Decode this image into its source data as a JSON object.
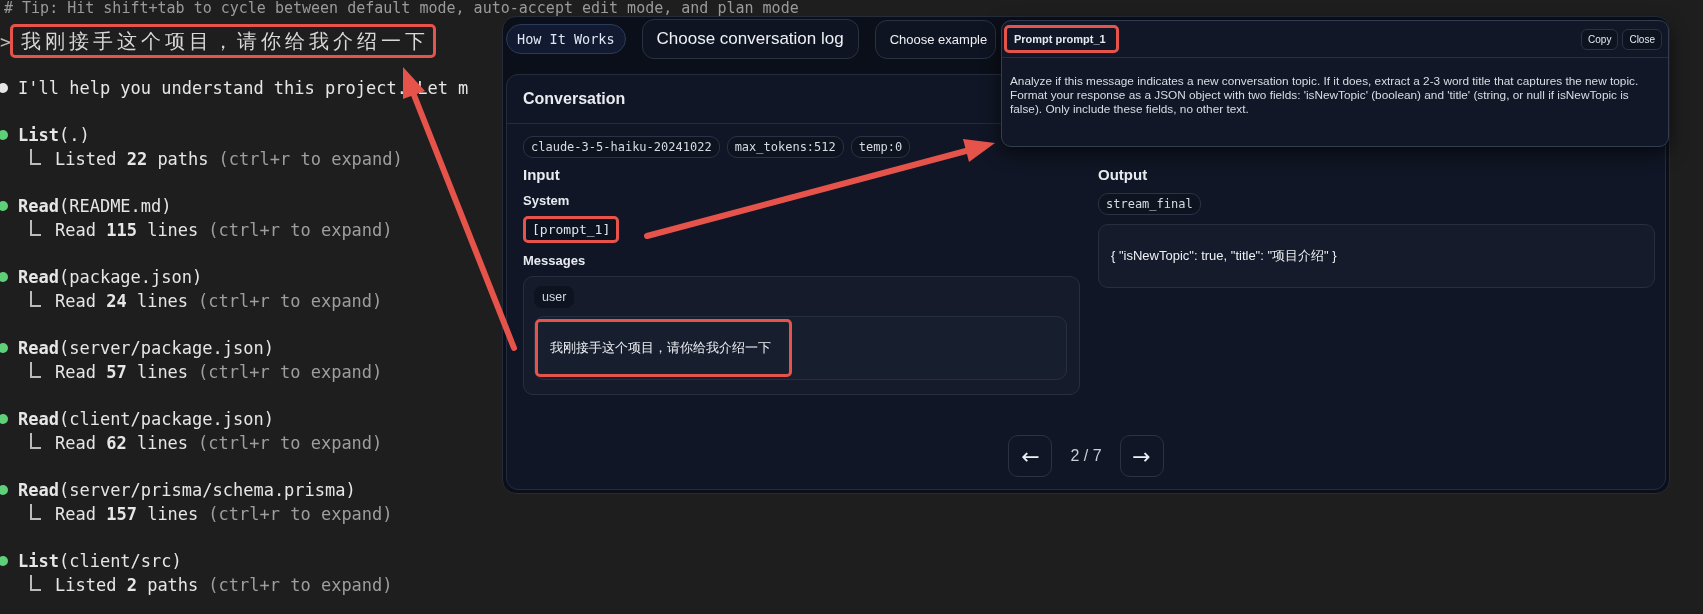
{
  "terminal": {
    "tip": "# Tip: Hit shift+tab to cycle between default mode, auto-accept edit mode, and plan mode",
    "prompt": {
      "marker": ">",
      "text": "我刚接手这个项目，请你给我介绍一下",
      "highlighted": true
    },
    "messages": [
      {
        "kind": "text",
        "color": "#e6e6e6",
        "text": "I'll help you understand this project. Let m"
      },
      {
        "kind": "tool",
        "color": "#5fd07a",
        "call": "**List**(.)",
        "result": "Listed **22** paths",
        "hint": "(ctrl+r to expand)"
      },
      {
        "kind": "tool",
        "color": "#5fd07a",
        "call": "**Read**(README.md)",
        "result": "Read **115** lines",
        "hint": "(ctrl+r to expand)"
      },
      {
        "kind": "tool",
        "color": "#5fd07a",
        "call": "**Read**(package.json)",
        "result": "Read **24** lines",
        "hint": "(ctrl+r to expand)"
      },
      {
        "kind": "tool",
        "color": "#5fd07a",
        "call": "**Read**(server/package.json)",
        "result": "Read **57** lines",
        "hint": "(ctrl+r to expand)"
      },
      {
        "kind": "tool",
        "color": "#5fd07a",
        "call": "**Read**(client/package.json)",
        "result": "Read **62** lines",
        "hint": "(ctrl+r to expand)"
      },
      {
        "kind": "tool",
        "color": "#5fd07a",
        "call": "**Read**(server/prisma/schema.prisma)",
        "result": "Read **157** lines",
        "hint": "(ctrl+r to expand)"
      },
      {
        "kind": "tool",
        "color": "#5fd07a",
        "call": "**List**(client/src)",
        "result": "Listed **2** paths",
        "hint": "(ctrl+r to expand)"
      }
    ]
  },
  "app": {
    "top_buttons": [
      {
        "kind": "pill",
        "label": "How It Works"
      },
      {
        "kind": "button",
        "label": "Choose conversation log"
      },
      {
        "kind": "small",
        "label": "Choose example"
      }
    ],
    "conversation": {
      "title": "Conversation",
      "tags": [
        "claude-3-5-haiku-20241022",
        "max_tokens:512",
        "temp:0"
      ],
      "input": {
        "heading": "Input",
        "system_label": "System",
        "system_ref": {
          "text": "[prompt_1]",
          "highlighted": true
        },
        "messages_label": "Messages",
        "messages": [
          {
            "role": "user",
            "text": "我刚接手这个项目，请你给我介绍一下",
            "highlighted": true
          }
        ]
      },
      "output": {
        "heading": "Output",
        "tag": "stream_final",
        "text": "{ \"isNewTopic\": true, \"title\": \"项目介绍\" }"
      },
      "pagination": {
        "prev": "←",
        "page": "2 / 7",
        "next": "→"
      }
    },
    "popup": {
      "title": "Prompt prompt_1",
      "highlighted": true,
      "buttons": [
        "Copy",
        "Close"
      ],
      "body": "Analyze if this message indicates a new conversation topic. If it does, extract a 2-3 word title that captures the new topic. Format your response as a JSON object with two fields: 'isNewTopic' (boolean) and 'title' (string, or null if isNewTopic is false). Only include these fields, no other text."
    }
  }
}
